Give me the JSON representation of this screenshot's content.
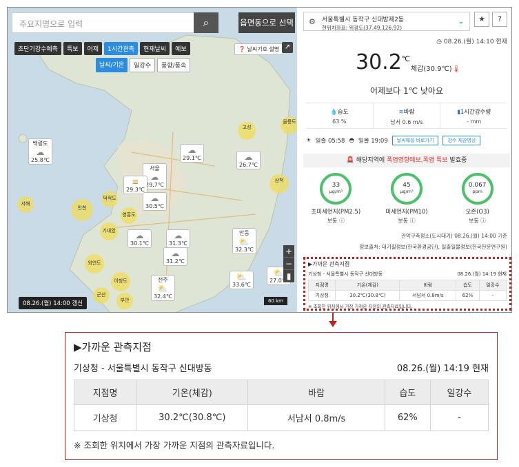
{
  "map": {
    "search_placeholder": "주요지명으로 입력",
    "search_icon": "search-icon",
    "region_button": "읍면동으로 선택",
    "tabs_row1": [
      "초단기강수예측",
      "특보",
      "어제",
      "1시간관측",
      "현재날씨",
      "예보"
    ],
    "active_tab": "1시간관측",
    "tabs_row2": [
      "날씨/기온",
      "일강수",
      "풍향/풍속"
    ],
    "legend_button": "날씨기호 설명",
    "markers": [
      {
        "id": "baengnyeong",
        "name": "백령도",
        "temp": "25.8℃"
      },
      {
        "id": "seoul",
        "name": "서울",
        "temp": "29.7℃"
      },
      {
        "id": "incheon-w",
        "name": "",
        "temp": "29.3℃"
      },
      {
        "id": "suwon",
        "name": "",
        "temp": "30.5℃"
      },
      {
        "id": "cheorwon",
        "name": "",
        "temp": "29.1℃"
      },
      {
        "id": "chuncheon",
        "name": "",
        "temp": "26.7℃"
      },
      {
        "id": "cheonan",
        "name": "",
        "temp": "30.1℃"
      },
      {
        "id": "cheongju",
        "name": "",
        "temp": "31.3℃"
      },
      {
        "id": "daejeon",
        "name": "",
        "temp": "31.2℃"
      },
      {
        "id": "andong",
        "name": "안동",
        "temp": "32.3℃"
      },
      {
        "id": "jeonju",
        "name": "전주",
        "temp": "32.4℃"
      },
      {
        "id": "daegu",
        "name": "",
        "temp": "33.6℃"
      },
      {
        "id": "pohang",
        "name": "",
        "temp": "27.0℃"
      }
    ],
    "rain_dots": [
      "고성",
      "울릉도",
      "삼척",
      "인천",
      "서해",
      "덕적도",
      "영흥도",
      "기대암",
      "외연도",
      "어청도",
      "군산",
      "부안"
    ],
    "zoom_in": "+",
    "zoom_out": "−",
    "time_badge": "08.26.(월) 14:00 갱신",
    "scale": "60 km"
  },
  "panel": {
    "location": "서울특별시 동작구 신대방제2동",
    "coords": "현위치좌표: 위경도(37.49,126.92)",
    "now": "08.26.(월) 14:10 현재",
    "temp": "30.2",
    "temp_unit": "℃",
    "feel": "체감(30.9℃)",
    "compare": "어제보다 1℃ 낮아요",
    "stats": [
      {
        "label": "습도",
        "value": "63 %"
      },
      {
        "label": "바람",
        "value": "남서 0.6 m/s"
      },
      {
        "label": "1시간강수량",
        "value": "- mm"
      }
    ],
    "sunrise": "일출 05:58",
    "sunset": "일몰 19:09",
    "btn1": "날씨해설 바로가기",
    "btn2": "강수 체감영상",
    "alert_prefix": "해당지역에",
    "alert_red": "폭염영향예보,폭염 특보",
    "alert_suffix": "발효중",
    "gauges": [
      {
        "value": "33",
        "unit": "μg/m³",
        "name": "초미세먼지(PM2.5)",
        "level": "보통"
      },
      {
        "value": "45",
        "unit": "μg/m³",
        "name": "미세먼지(PM10)",
        "level": "보통"
      },
      {
        "value": "0.067",
        "unit": "ppm",
        "name": "오존(O3)",
        "level": "보통"
      }
    ],
    "credit1": "관악구측정소(도시대기) 08.26.(월) 14:00 기준",
    "credit2": "정보출처: 대기질정보(한국환경공단), 일출일몰정보(한국천문연구원)"
  },
  "nearby": {
    "title": "▶가까운 관측지점",
    "station": "기상청 - 서울특별시 동작구 신대방동",
    "time": "08.26.(월) 14:19 현재",
    "headers": [
      "지점명",
      "기온(체감)",
      "바람",
      "습도",
      "일강수"
    ],
    "row": [
      "기상청",
      "30.2℃(30.8℃)",
      "서남서 0.8m/s",
      "62%",
      "-"
    ],
    "note": "※ 조회한 위치에서 가장 가까운 지점의 관측자료입니다."
  },
  "colors": {
    "accent": "#2c8de0",
    "highlight": "#c0201e",
    "good": "#4cc06a"
  }
}
